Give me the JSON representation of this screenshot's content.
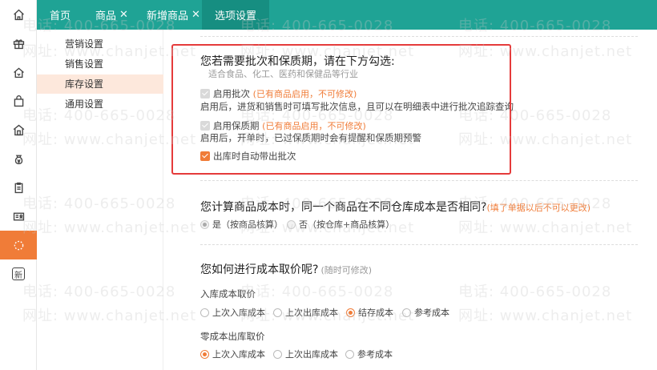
{
  "rail": {
    "items": [
      {
        "icon": "home-icon"
      },
      {
        "icon": "gift-icon"
      },
      {
        "icon": "house-in-icon"
      },
      {
        "icon": "bag-icon"
      },
      {
        "icon": "store-icon"
      },
      {
        "icon": "money-bag-icon"
      },
      {
        "icon": "clipboard-icon"
      },
      {
        "icon": "id-card-icon"
      },
      {
        "icon": "loading-circle-icon",
        "active": true
      },
      {
        "icon": "new-badge-icon",
        "glyph": "新"
      }
    ]
  },
  "tabs": [
    {
      "label": "首页",
      "closable": false
    },
    {
      "label": "商品",
      "closable": true
    },
    {
      "label": "新增商品",
      "closable": true
    },
    {
      "label": "选项设置",
      "closable": false,
      "active": true
    }
  ],
  "tab_close_glyph": "✕",
  "submenu": {
    "items": [
      {
        "label": "营销设置"
      },
      {
        "label": "销售设置"
      },
      {
        "label": "库存设置",
        "active": true
      },
      {
        "label": "通用设置"
      }
    ]
  },
  "batch": {
    "title": "您若需要批次和保质期，请在下方勾选:",
    "subtitle": "适合食品、化工、医药和保健品等行业",
    "enable_batch_label": "启用批次",
    "enable_batch_note": "(已有商品启用，不可修改)",
    "enable_batch_desc": "启用后，进货和销售时可填写批次信息，且可以在明细表中进行批次追踪查询",
    "enable_shelf_label": "启用保质期",
    "enable_shelf_note": "(已有商品启用，不可修改)",
    "enable_shelf_desc": "启用后，开单时，已过保质期时会有提醒和保质期预警",
    "auto_batch_label": "出库时自动带出批次"
  },
  "cost_same": {
    "title": "您计算商品成本时，同一个商品在不同仓库成本是否相同?",
    "note": "(填了单据以后不可以更改)",
    "opt_yes": "是（按商品核算）",
    "opt_no": "否（按仓库+商品核算）"
  },
  "cost_method": {
    "title": "您如何进行成本取价呢?",
    "note": "(随时可修改)",
    "in_label": "入库成本取价",
    "in_options": [
      "上次入库成本",
      "上次出库成本",
      "结存成本",
      "参考成本"
    ],
    "in_selected": 2,
    "zero_label": "零成本出库取价",
    "zero_options": [
      "上次入库成本",
      "上次出库成本",
      "参考成本"
    ],
    "zero_selected": 0
  },
  "watermark": {
    "phone": "电话: 400-665-0028",
    "site": "网址: www.chanjet.net"
  },
  "colors": {
    "tabbar": "#1fa395",
    "accent": "#f07c38",
    "highlight_border": "#e53b3b"
  }
}
